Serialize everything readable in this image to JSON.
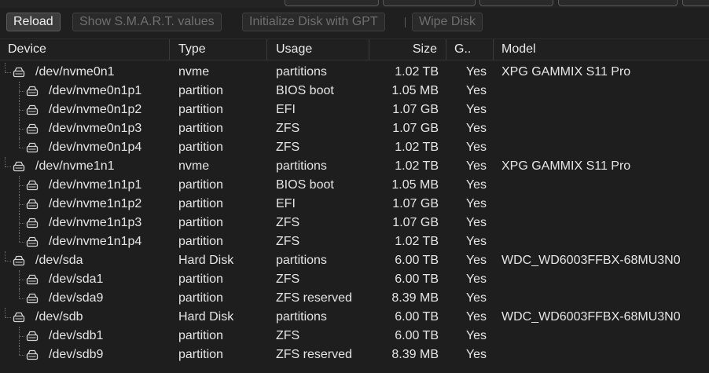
{
  "toolbar": {
    "reload": "Reload",
    "smart": "Show S.M.A.R.T. values",
    "init_gpt": "Initialize Disk with GPT",
    "wipe": "Wipe Disk"
  },
  "columns": {
    "device": "Device",
    "type": "Type",
    "usage": "Usage",
    "size": "Size",
    "gpt": "G..",
    "model": "Model"
  },
  "rows": [
    {
      "device": "/dev/nvme0n1",
      "level": 0,
      "type": "nvme",
      "usage": "partitions",
      "size": "1.02 TB",
      "gpt": "Yes",
      "model": "XPG GAMMIX S11 Pro"
    },
    {
      "device": "/dev/nvme0n1p1",
      "level": 1,
      "type": "partition",
      "usage": "BIOS boot",
      "size": "1.05 MB",
      "gpt": "Yes",
      "model": ""
    },
    {
      "device": "/dev/nvme0n1p2",
      "level": 1,
      "type": "partition",
      "usage": "EFI",
      "size": "1.07 GB",
      "gpt": "Yes",
      "model": ""
    },
    {
      "device": "/dev/nvme0n1p3",
      "level": 1,
      "type": "partition",
      "usage": "ZFS",
      "size": "1.07 GB",
      "gpt": "Yes",
      "model": ""
    },
    {
      "device": "/dev/nvme0n1p4",
      "level": 1,
      "type": "partition",
      "usage": "ZFS",
      "size": "1.02 TB",
      "gpt": "Yes",
      "model": ""
    },
    {
      "device": "/dev/nvme1n1",
      "level": 0,
      "type": "nvme",
      "usage": "partitions",
      "size": "1.02 TB",
      "gpt": "Yes",
      "model": "XPG GAMMIX S11 Pro"
    },
    {
      "device": "/dev/nvme1n1p1",
      "level": 1,
      "type": "partition",
      "usage": "BIOS boot",
      "size": "1.05 MB",
      "gpt": "Yes",
      "model": ""
    },
    {
      "device": "/dev/nvme1n1p2",
      "level": 1,
      "type": "partition",
      "usage": "EFI",
      "size": "1.07 GB",
      "gpt": "Yes",
      "model": ""
    },
    {
      "device": "/dev/nvme1n1p3",
      "level": 1,
      "type": "partition",
      "usage": "ZFS",
      "size": "1.07 GB",
      "gpt": "Yes",
      "model": ""
    },
    {
      "device": "/dev/nvme1n1p4",
      "level": 1,
      "type": "partition",
      "usage": "ZFS",
      "size": "1.02 TB",
      "gpt": "Yes",
      "model": ""
    },
    {
      "device": "/dev/sda",
      "level": 0,
      "type": "Hard Disk",
      "usage": "partitions",
      "size": "6.00 TB",
      "gpt": "Yes",
      "model": "WDC_WD6003FFBX-68MU3N0"
    },
    {
      "device": "/dev/sda1",
      "level": 1,
      "type": "partition",
      "usage": "ZFS",
      "size": "6.00 TB",
      "gpt": "Yes",
      "model": ""
    },
    {
      "device": "/dev/sda9",
      "level": 1,
      "type": "partition",
      "usage": "ZFS reserved",
      "size": "8.39 MB",
      "gpt": "Yes",
      "model": ""
    },
    {
      "device": "/dev/sdb",
      "level": 0,
      "type": "Hard Disk",
      "usage": "partitions",
      "size": "6.00 TB",
      "gpt": "Yes",
      "model": "WDC_WD6003FFBX-68MU3N0"
    },
    {
      "device": "/dev/sdb1",
      "level": 1,
      "type": "partition",
      "usage": "ZFS",
      "size": "6.00 TB",
      "gpt": "Yes",
      "model": ""
    },
    {
      "device": "/dev/sdb9",
      "level": 1,
      "type": "partition",
      "usage": "ZFS reserved",
      "size": "8.39 MB",
      "gpt": "Yes",
      "model": ""
    }
  ]
}
